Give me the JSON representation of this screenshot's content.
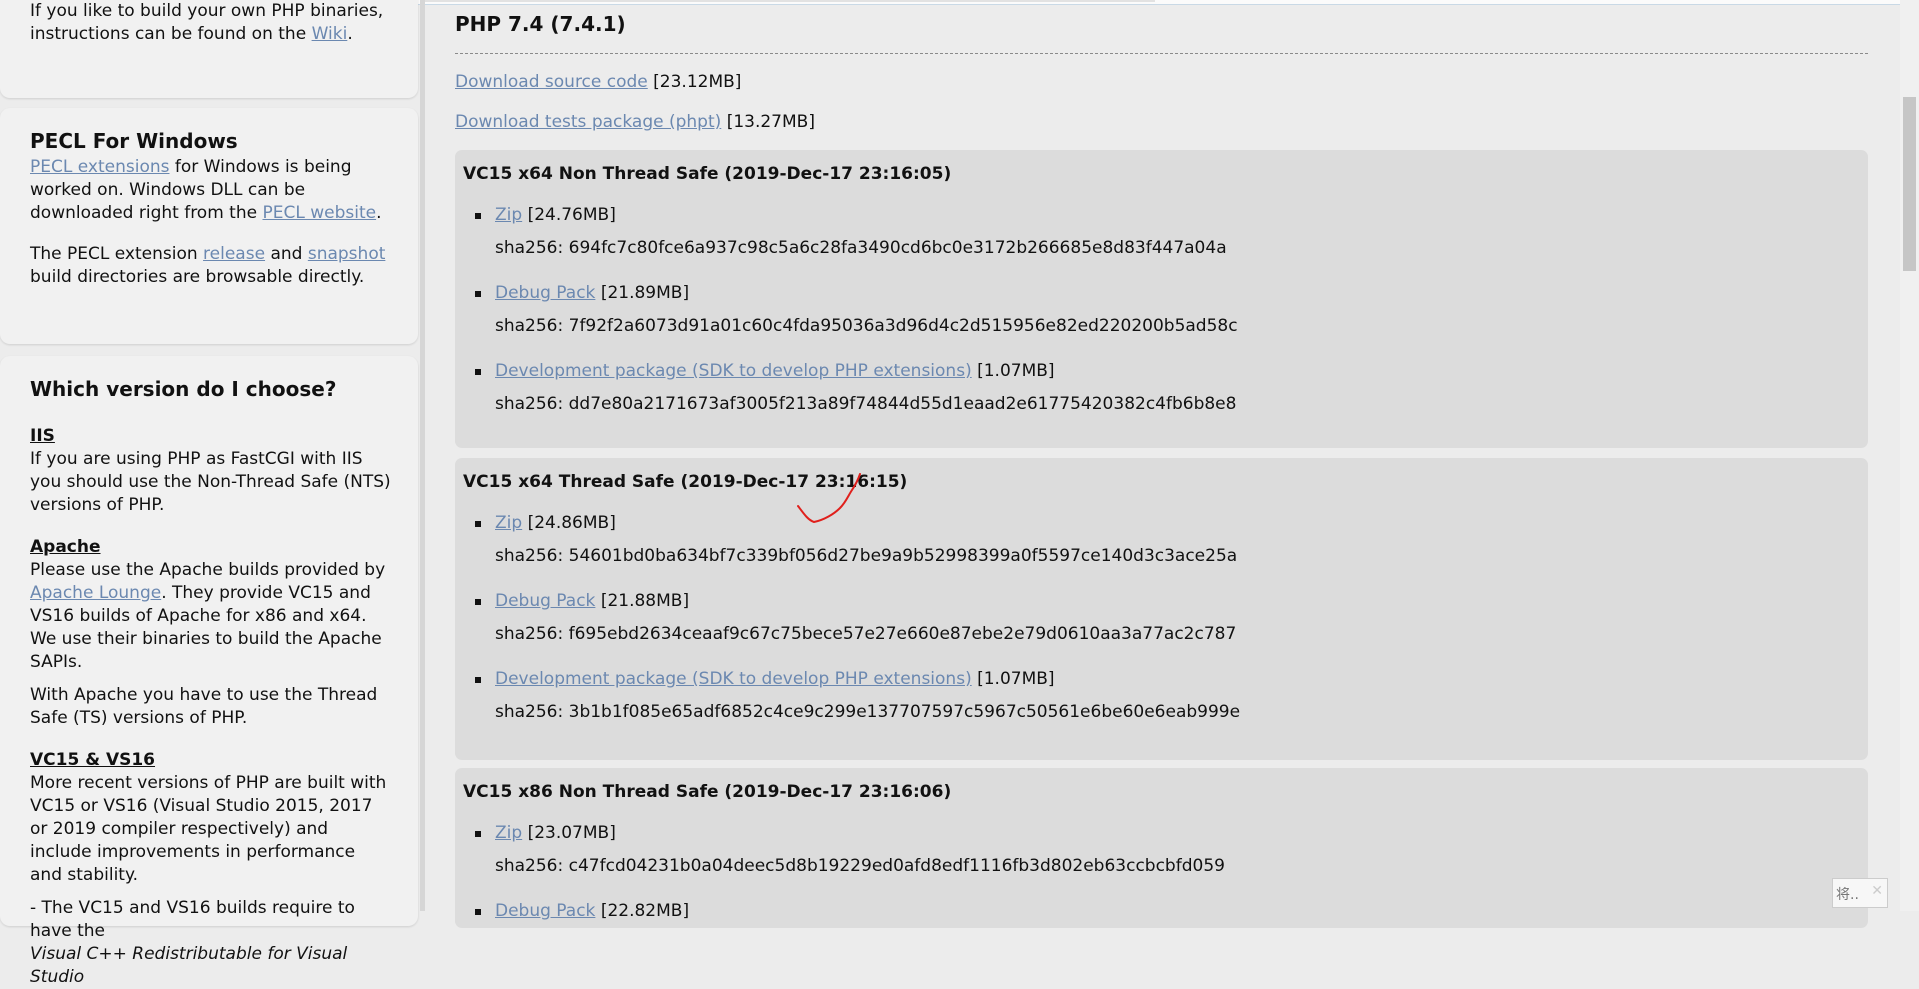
{
  "sidebar": {
    "top_text": "If you like to build your own PHP binaries, instructions can be found on the",
    "top_link": "Wiki",
    "pecl": {
      "title": "PECL For Windows",
      "link1": "PECL extensions",
      "text1": "for Windows is being worked on. Windows DLL can be downloaded right from the",
      "link2": "PECL website",
      "text2": "The PECL extension",
      "link_release": "release",
      "and": "and",
      "link_snapshot": "snapshot",
      "text3": "build directories are browsable directly."
    },
    "which": {
      "title": "Which version do I choose?",
      "iis_heading": "IIS",
      "iis_text": "If you are using PHP as FastCGI with IIS you should use the Non-Thread Safe (NTS) versions of PHP.",
      "apache_heading": "Apache",
      "apache_text1": "Please use the Apache builds provided by",
      "apache_link": "Apache Lounge",
      "apache_text2": ". They provide VC15 and VS16 builds of Apache for x86 and x64. We use their binaries to build the Apache SAPIs.",
      "apache_text3": "With Apache you have to use the Thread Safe (TS) versions of PHP.",
      "vc_heading": "VC15 & VS16",
      "vc_text": "More recent versions of PHP are built with VC15 or VS16 (Visual Studio 2015, 2017 or 2019 compiler respectively) and include improvements in performance and stability.",
      "vc_text2": "- The VC15 and VS16 builds require to have the",
      "vc_text3": "Visual C++ Redistributable for Visual Studio"
    }
  },
  "main": {
    "version_title": "PHP 7.4 (7.4.1)",
    "source_link": "Download source code",
    "source_size": "[23.12MB]",
    "tests_link": "Download tests package (phpt)",
    "tests_size": "[13.27MB]",
    "builds": [
      {
        "title": "VC15 x64 Non Thread Safe (2019-Dec-17 23:16:05)",
        "items": [
          {
            "link": "Zip",
            "size": "[24.76MB]",
            "sha": "sha256: 694fc7c80fce6a937c98c5a6c28fa3490cd6bc0e3172b266685e8d83f447a04a"
          },
          {
            "link": "Debug Pack",
            "size": "[21.89MB]",
            "sha": "sha256: 7f92f2a6073d91a01c60c4fda95036a3d96d4c2d515956e82ed220200b5ad58c"
          },
          {
            "link": "Development package (SDK to develop PHP extensions)",
            "size": "[1.07MB]",
            "sha": "sha256: dd7e80a2171673af3005f213a89f74844d55d1eaad2e61775420382c4fb6b8e8"
          }
        ]
      },
      {
        "title": "VC15 x64 Thread Safe (2019-Dec-17 23:16:15)",
        "items": [
          {
            "link": "Zip",
            "size": "[24.86MB]",
            "sha": "sha256: 54601bd0ba634bf7c339bf056d27be9a9b52998399a0f5597ce140d3c3ace25a"
          },
          {
            "link": "Debug Pack",
            "size": "[21.88MB]",
            "sha": "sha256: f695ebd2634ceaaf9c67c75bece57e27e660e87ebe2e79d0610aa3a77ac2c787"
          },
          {
            "link": "Development package (SDK to develop PHP extensions)",
            "size": "[1.07MB]",
            "sha": "sha256: 3b1b1f085e65adf6852c4ce9c299e137707597c5967c50561e6be60e6eab999e"
          }
        ]
      },
      {
        "title": "VC15 x86 Non Thread Safe (2019-Dec-17 23:16:06)",
        "items": [
          {
            "link": "Zip",
            "size": "[23.07MB]",
            "sha": "sha256: c47fcd04231b0a04deec5d8b19229ed0afd8edf1116fb3d802eb63ccbcbfd059"
          },
          {
            "link": "Debug Pack",
            "size": "[22.82MB]",
            "sha": ""
          }
        ]
      }
    ]
  },
  "overlay": {
    "corner_text": "将..",
    "corner_close": "✕"
  },
  "colors": {
    "link": "#6b88b0",
    "panel_bg": "#f1f1f1",
    "build_bg": "#dcdcdc",
    "annotation_mark": "#e0201c"
  }
}
